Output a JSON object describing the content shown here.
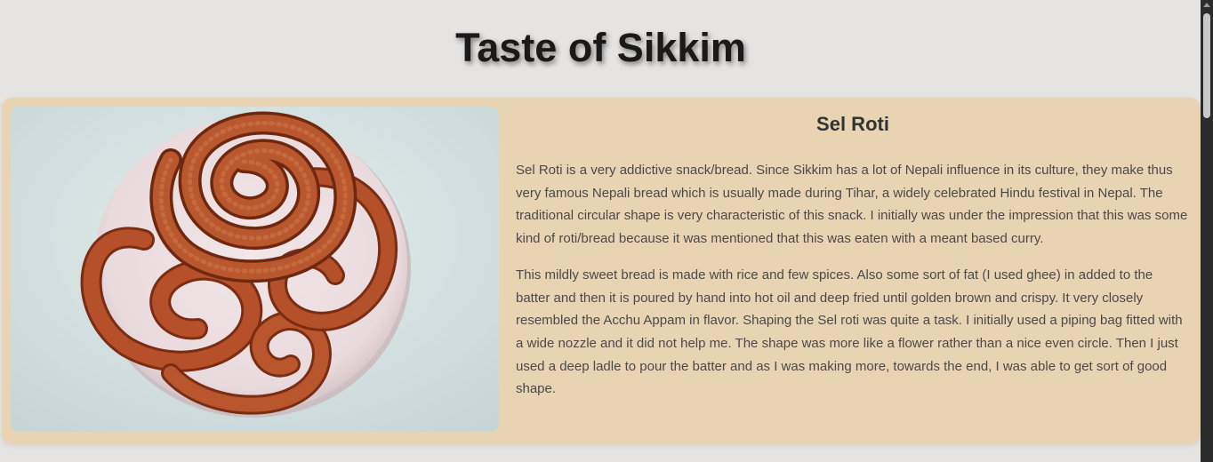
{
  "page": {
    "title": "Taste of Sikkim"
  },
  "dish": {
    "title": "Sel Roti",
    "image_icon": "sel-roti-photo",
    "paragraphs": [
      "Sel Roti is a very addictive snack/bread. Since Sikkim has a lot of Nepali influence in its culture, they make thus very famous Nepali bread which is usually made during Tihar, a widely celebrated Hindu festival in Nepal. The traditional circular shape is very characteristic of this snack. I initially was under the impression that this was some kind of roti/bread because it was mentioned that this was eaten with a meant based curry.",
      "This mildly sweet bread is made with rice and few spices. Also some sort of fat (I used ghee) in added to the batter and then it is poured by hand into hot oil and deep fried until golden brown and crispy. It very closely resembled the Acchu Appam in flavor. Shaping the Sel roti was quite a task. I initially used a piping bag fitted with a wide nozzle and it did not help me. The shape was more like a flower rather than a nice even circle. Then I just used a deep ladle to pour the batter and as I was making more, towards the end, I was able to get sort of good shape."
    ]
  },
  "colors": {
    "background": "#e6e4e2",
    "card": "#e8d4b2",
    "fried_bread": "#b5502a"
  }
}
